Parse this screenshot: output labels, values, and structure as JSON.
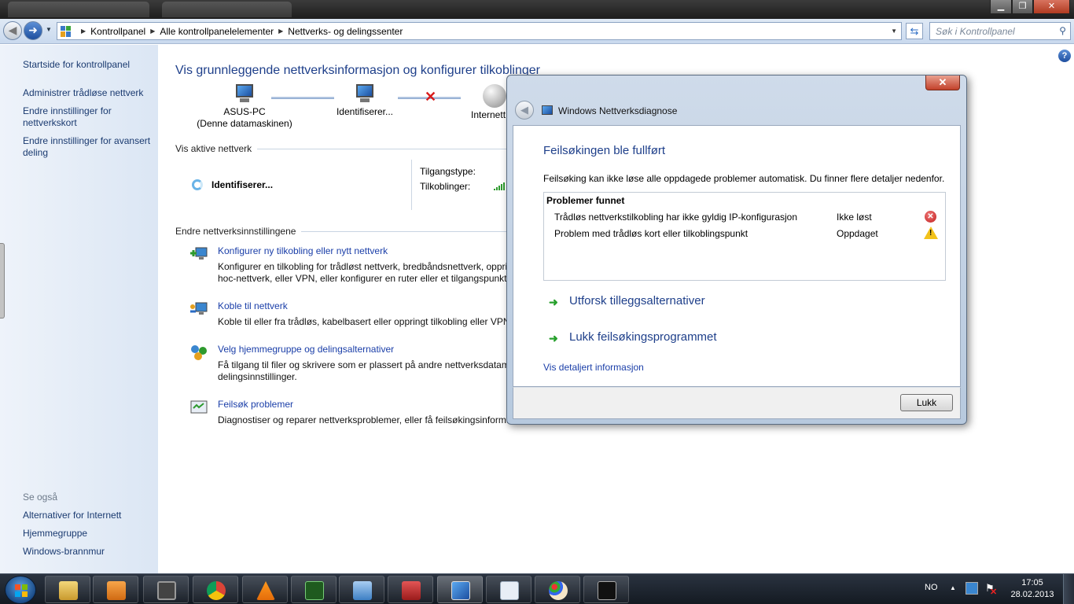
{
  "window": {
    "minimize_glyph": "▁",
    "maximize_glyph": "❐",
    "close_glyph": "✕"
  },
  "nav": {
    "breadcrumbs": [
      "Kontrollpanel",
      "Alle kontrollpanelelementer",
      "Nettverks- og delingssenter"
    ],
    "search_placeholder": "Søk i Kontrollpanel"
  },
  "sidebar": {
    "home": "Startside for kontrollpanel",
    "links": [
      "Administrer trådløse nettverk",
      "Endre innstillinger for nettverkskort",
      "Endre innstillinger for avansert deling"
    ],
    "see_also_label": "Se også",
    "see_also": [
      "Alternativer for Internett",
      "Hjemmegruppe",
      "Windows-brannmur"
    ]
  },
  "main": {
    "title": "Vis grunnleggende nettverksinformasjon og konfigurer tilkoblinger",
    "map": {
      "pc_name": "ASUS-PC",
      "pc_sub": "(Denne datamaskinen)",
      "middle": "Identifiserer...",
      "internet": "Internett"
    },
    "active_networks_label": "Vis aktive nettverk",
    "active_network_name": "Identifiserer...",
    "access_type_label": "Tilgangstype:",
    "connections_label": "Tilkoblinger:",
    "change_settings_label": "Endre nettverksinnstillingene",
    "tasks": [
      {
        "link": "Konfigurer ny tilkobling eller nytt nettverk",
        "desc1": "Konfigurer en tilkobling for trådløst nettverk, bredbåndsnettverk, oppri",
        "desc2": "hoc-nettverk, eller VPN, eller konfigurer en ruter eller et tilgangspunkt"
      },
      {
        "link": "Koble til nettverk",
        "desc1": "Koble til eller fra trådløs, kabelbasert eller oppringt tilkobling eller VPN",
        "desc2": ""
      },
      {
        "link": "Velg hjemmegruppe og delingsalternativer",
        "desc1": "Få tilgang til filer og skrivere som er plassert på andre nettverksdatama",
        "desc2": "delingsinnstillinger."
      },
      {
        "link": "Feilsøk problemer",
        "desc1": "Diagnostiser og reparer nettverksproblemer, eller få feilsøkingsinforma",
        "desc2": ""
      }
    ]
  },
  "dialog": {
    "title": "Windows Nettverksdiagnose",
    "heading": "Feilsøkingen ble fullført",
    "description": "Feilsøking kan ikke løse alle oppdagede problemer automatisk. Du finner flere detaljer nedenfor.",
    "problems_header": "Problemer funnet",
    "problems": [
      {
        "desc": "Trådløs nettverkstilkobling har ikke gyldig IP-konfigurasjon",
        "status": "Ikke løst",
        "icon": "error-icon"
      },
      {
        "desc": "Problem med trådløs kort eller tilkoblingspunkt",
        "status": "Oppdaget",
        "icon": "warning-icon"
      }
    ],
    "options": [
      "Utforsk tilleggsalternativer",
      "Lukk feilsøkingsprogrammet"
    ],
    "details_link": "Vis detaljert informasjon",
    "close_button": "Lukk"
  },
  "taskbar": {
    "language": "NO",
    "time": "17:05",
    "date": "28.02.2013",
    "apps": [
      "explorer",
      "media-player",
      "video-capture",
      "chrome",
      "vlc",
      "network-tool",
      "remote-desktop",
      "toolbox",
      "network-diagnostic",
      "notepad",
      "paint",
      "command-prompt"
    ]
  },
  "colors": {
    "link": "#1a3ea8",
    "heading": "#1e3f8a",
    "sidebar_bg": "#e4ecf7",
    "ok_green": "#27a02c",
    "error_red": "#c11c1c",
    "warn_yellow": "#f2c21b"
  }
}
